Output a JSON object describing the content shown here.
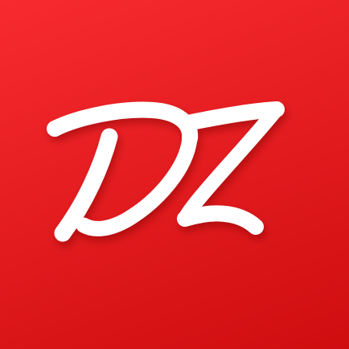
{
  "icon": {
    "logo_text": "DZ",
    "colors": {
      "background_top": "#f72b2f",
      "background_bottom": "#cf0d0f",
      "glyph": "#ffffff",
      "shadow": "#7a0000"
    }
  }
}
